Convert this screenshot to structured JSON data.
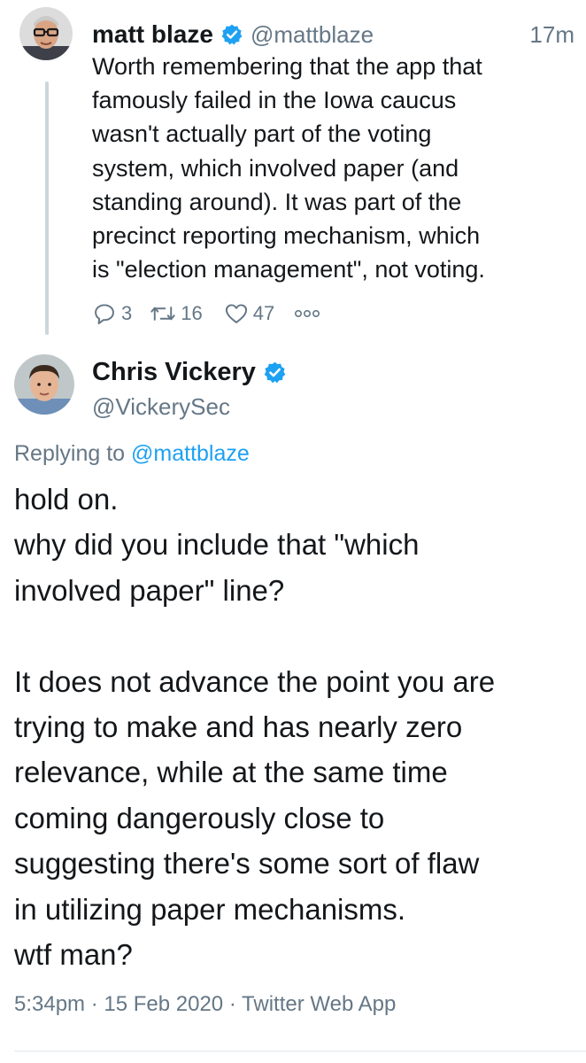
{
  "thread": {
    "tweet1": {
      "author_name": "matt blaze",
      "handle": "@mattblaze",
      "time": "17m",
      "text": "Worth remembering that the app that\nfamously failed in the Iowa caucus\nwasn't actually part of the voting\nsystem, which involved paper (and\nstanding around). It was part of the\nprecinct reporting mechanism, which\nis \"election management\", not voting.",
      "reply_count": "3",
      "retweet_count": "16",
      "like_count": "47",
      "more_label": "ooo"
    },
    "tweet2": {
      "author_name": "Chris Vickery",
      "handle": "@VickerySec",
      "replying_prefix": "Replying to ",
      "replying_to": "@mattblaze",
      "text": "hold on.\nwhy did you include that \"which\ninvolved paper\" line?\n\nIt does not advance the point you are\ntrying to make and has nearly zero\nrelevance, while at the same time\ncoming dangerously close to\nsuggesting there's some sort of flaw\nin utilizing paper mechanisms.\nwtf man?",
      "timestamp": "5:34pm · 15 Feb 2020 · Twitter Web App"
    }
  },
  "icons": {
    "verified": "verified-badge-icon",
    "reply": "reply-icon",
    "retweet": "retweet-icon",
    "like": "heart-icon",
    "more": "more-icon"
  },
  "colors": {
    "accent": "#1da1f2",
    "secondary_text": "#657786",
    "primary_text": "#14171a",
    "thread_line": "#ccd6dd"
  }
}
